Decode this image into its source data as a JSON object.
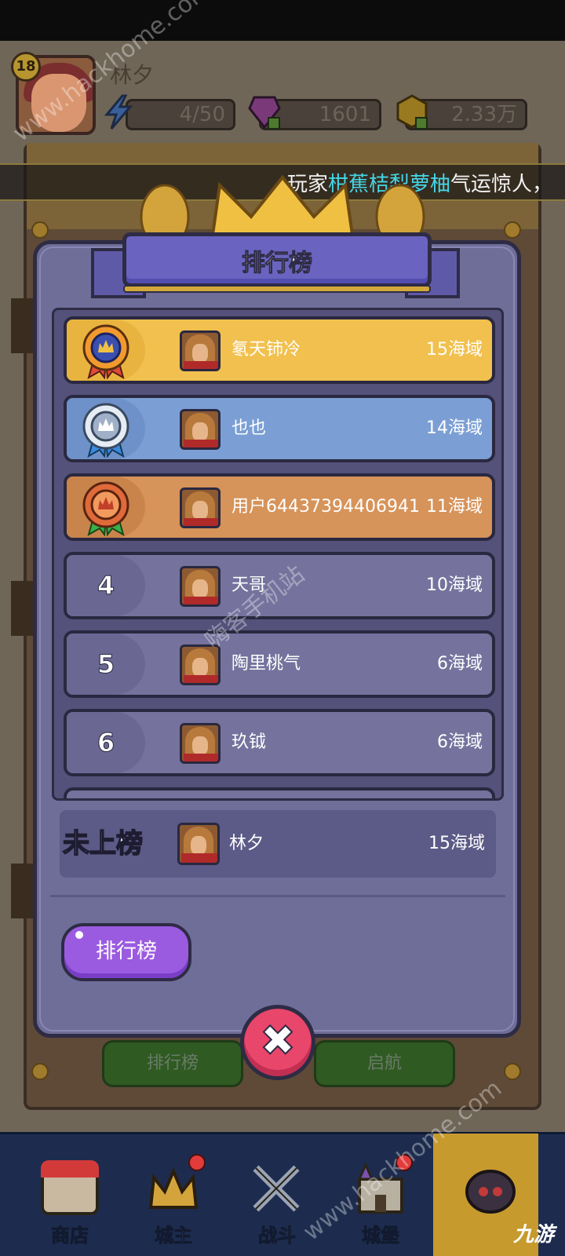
{
  "hud": {
    "level": "18",
    "player_name": "林夕",
    "energy": "4/50",
    "gems": "1601",
    "coins": "2.33万"
  },
  "marquee": {
    "prefix": "玩家",
    "highlight": "柑蕉桔梨萝柚",
    "suffix": "气运惊人，"
  },
  "background": {
    "button_left": "排行榜",
    "button_right": "启航"
  },
  "dialog": {
    "title": "排行榜",
    "rows": [
      {
        "rank": "1",
        "name": "氡天铈冷",
        "score": "15海域",
        "tier": "gold"
      },
      {
        "rank": "2",
        "name": "也也",
        "score": "14海域",
        "tier": "silver"
      },
      {
        "rank": "3",
        "name": "用户64437394406941",
        "score": "11海域",
        "tier": "bronze"
      },
      {
        "rank": "4",
        "name": "天哥",
        "score": "10海域",
        "tier": "plain"
      },
      {
        "rank": "5",
        "name": "陶里桃气",
        "score": "6海域",
        "tier": "plain"
      },
      {
        "rank": "6",
        "name": "玖钺",
        "score": "6海域",
        "tier": "plain"
      }
    ],
    "my_entry": {
      "rank_text": "未上榜",
      "name": "林夕",
      "score": "15海域"
    },
    "leaderboard_button": "排行榜",
    "close_icon": "close-x-icon"
  },
  "bottom_nav": {
    "items": [
      {
        "label": "商店",
        "icon": "shop-icon"
      },
      {
        "label": "城主",
        "icon": "crown-icon"
      },
      {
        "label": "战斗",
        "icon": "swords-icon"
      },
      {
        "label": "城堡",
        "icon": "castle-icon"
      }
    ]
  },
  "watermarks": {
    "top": "www.hackhome.com",
    "middle": "嗨客手机站",
    "bottom": "www.hackhome.com",
    "corner": "九游"
  },
  "colors": {
    "gold_row": "#f1c04e",
    "silver_row": "#7b9fd4",
    "bronze_row": "#d6935a",
    "dialog_bg": "#6f6e99",
    "title_banner": "#6a64c0",
    "purple_button": "#9b5be0",
    "close_button": "#e8466a",
    "marquee_highlight": "#45d6e6"
  }
}
